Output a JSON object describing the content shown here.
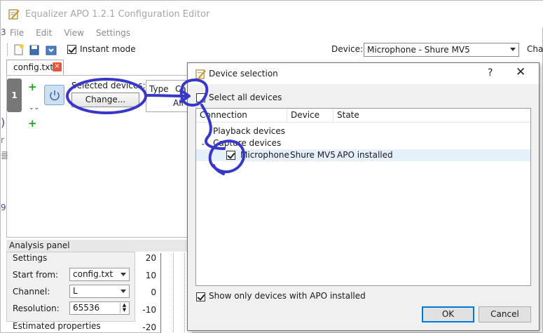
{
  "window": {
    "title": "Equalizer APO 1.2.1 Configuration Editor"
  },
  "menu": [
    "File",
    "Edit",
    "View",
    "Settings"
  ],
  "toolbar": {
    "instant_mode_label": "Instant mode",
    "instant_mode_checked": true,
    "device_label": "Device:",
    "device_value": "Microphone - Shure MV5",
    "channel_label_partial": "Cha"
  },
  "tab": {
    "label": "config.txt",
    "close_icon": "close-icon"
  },
  "filter_row": {
    "number": "1",
    "selected_devices_label": "Selected devices:",
    "change_button": "Change...",
    "type_label": "Type",
    "channel_partial": "Ca",
    "all_partial": "All"
  },
  "side_marks": [
    "3",
    ")",
    "r",
    "를",
    "9"
  ],
  "analysis": {
    "panel_title": "Analysis panel",
    "settings_title": "Settings",
    "start_from_label": "Start from:",
    "start_from_value": "config.txt",
    "channel_label": "Channel:",
    "channel_value": "L",
    "resolution_label": "Resolution:",
    "resolution_value": "65536",
    "estimated_label": "Estimated properties",
    "y_axis_ticks": [
      "20",
      "10",
      "0",
      "-10",
      "-20"
    ]
  },
  "dialog": {
    "title": "Device selection",
    "help": "?",
    "close": "✕",
    "select_all_label": "Select all devices",
    "select_all_checked": false,
    "columns": [
      "Connection",
      "Device",
      "State"
    ],
    "tree": {
      "playback": "Playback devices",
      "capture": "Capture devices",
      "device_connection": "Microphone",
      "device_name": "Shure MV5",
      "device_state": "APO installed",
      "device_checked": true
    },
    "show_only_label": "Show only devices with APO installed",
    "show_only_checked": true,
    "ok": "OK",
    "cancel": "Cancel"
  },
  "colors": {
    "annotation": "#3838c8",
    "selection": "#e6f0fa",
    "ok_border": "#0078d7",
    "add_icon": "#22a022"
  }
}
